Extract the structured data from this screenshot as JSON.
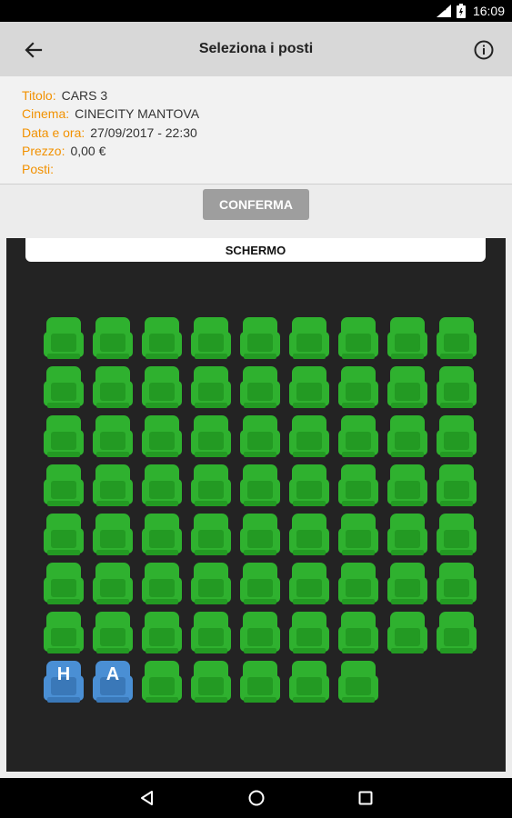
{
  "status_bar": {
    "time": "16:09"
  },
  "toolbar": {
    "title": "Seleziona i posti",
    "back_icon": "arrow-left-icon",
    "info_icon": "info-circle-icon"
  },
  "details": {
    "rows": [
      {
        "label": "Titolo:",
        "value": "CARS 3"
      },
      {
        "label": "Cinema:",
        "value": "CINECITY MANTOVA"
      },
      {
        "label": "Data e ora:",
        "value": "27/09/2017 - 22:30"
      },
      {
        "label": "Prezzo:",
        "value": "0,00 €"
      },
      {
        "label": "Posti:",
        "value": ""
      }
    ],
    "label_color": "#f29100"
  },
  "confirm": {
    "label": "CONFERMA"
  },
  "hall": {
    "screen_label": "SCHERMO",
    "colors": {
      "available": "#2fb12f",
      "accessible": "#4a8fd4"
    },
    "rows": [
      {
        "seats": [
          "available",
          "available",
          "available",
          "available",
          "available",
          "available",
          "available",
          "available",
          "available"
        ]
      },
      {
        "seats": [
          "available",
          "available",
          "available",
          "available",
          "available",
          "available",
          "available",
          "available",
          "available"
        ]
      },
      {
        "seats": [
          "available",
          "available",
          "available",
          "available",
          "available",
          "available",
          "available",
          "available",
          "available"
        ]
      },
      {
        "seats": [
          "available",
          "available",
          "available",
          "available",
          "available",
          "available",
          "available",
          "available",
          "available"
        ]
      },
      {
        "seats": [
          "available",
          "available",
          "available",
          "available",
          "available",
          "available",
          "available",
          "available",
          "available"
        ]
      },
      {
        "seats": [
          "available",
          "available",
          "available",
          "available",
          "available",
          "available",
          "available",
          "available",
          "available"
        ]
      },
      {
        "seats": [
          "available",
          "available",
          "available",
          "available",
          "available",
          "available",
          "available",
          "available",
          "available"
        ]
      },
      {
        "seats": [
          "accessible",
          "accessible",
          "available",
          "available",
          "available",
          "available",
          "available"
        ],
        "letters": [
          "H",
          "A"
        ]
      }
    ]
  },
  "nav_bar": {
    "icons": [
      "back-triangle-icon",
      "home-circle-icon",
      "recents-square-icon"
    ]
  }
}
